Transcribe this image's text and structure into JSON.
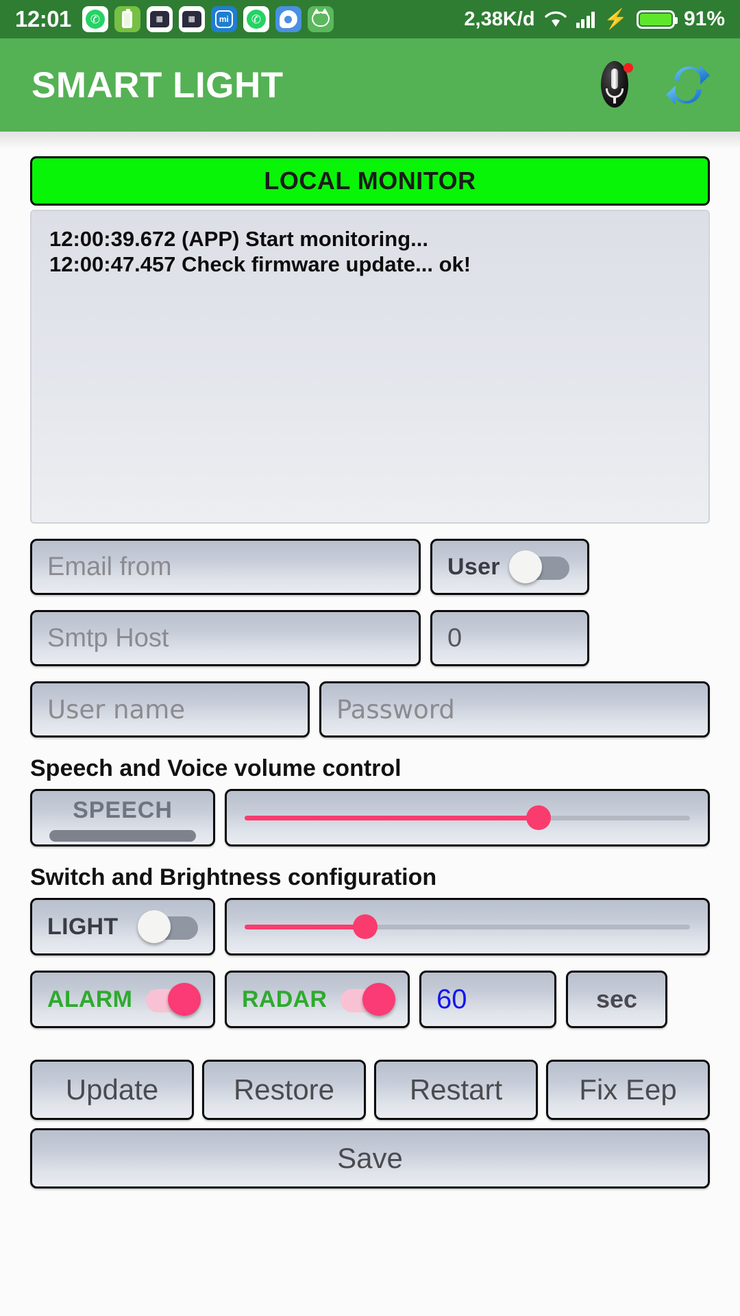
{
  "statusbar": {
    "clock": "12:01",
    "network_speed": "2,38K/d",
    "battery_percent": "91%",
    "app_icons": [
      "whatsapp-icon",
      "battery-app-icon",
      "blackberry-messenger-icon",
      "blackberry-messenger-icon",
      "mi-icon",
      "whatsapp-icon",
      "messenger-icon",
      "android-icon"
    ],
    "mi_label": "mi"
  },
  "appbar": {
    "title": "SMART LIGHT",
    "mic_icon": "microphone-icon",
    "sync_icon": "sync-refresh-icon"
  },
  "monitor": {
    "header": "LOCAL MONITOR",
    "lines": [
      "12:00:39.672 (APP) Start monitoring...",
      "12:00:47.457 Check firmware update... ok!"
    ]
  },
  "form": {
    "email_from_placeholder": "Email from",
    "user_toggle_label": "User",
    "user_toggle_on": false,
    "smtp_host_placeholder": "Smtp Host",
    "port_value": "0",
    "username_placeholder": "User name",
    "password_placeholder": "Password"
  },
  "speech": {
    "section_title": "Speech and Voice volume control",
    "button_label": "SPEECH",
    "volume_percent": 66
  },
  "switches": {
    "section_title": "Switch and Brightness configuration",
    "light_label": "LIGHT",
    "light_on": false,
    "brightness_percent": 27,
    "alarm_label": "ALARM",
    "alarm_on": true,
    "radar_label": "RADAR",
    "radar_on": true,
    "seconds_value": "60",
    "seconds_unit": "sec"
  },
  "actions": {
    "update": "Update",
    "restore": "Restore",
    "restart": "Restart",
    "fix_eep": "Fix Eep",
    "save": "Save"
  },
  "colors": {
    "appbar_green": "#54b154",
    "statusbar_green": "#2e7d32",
    "monitor_green": "#08f508",
    "toggle_pink": "#fa3b6e",
    "label_green": "#2eaa2e",
    "value_blue": "#1414f0"
  }
}
